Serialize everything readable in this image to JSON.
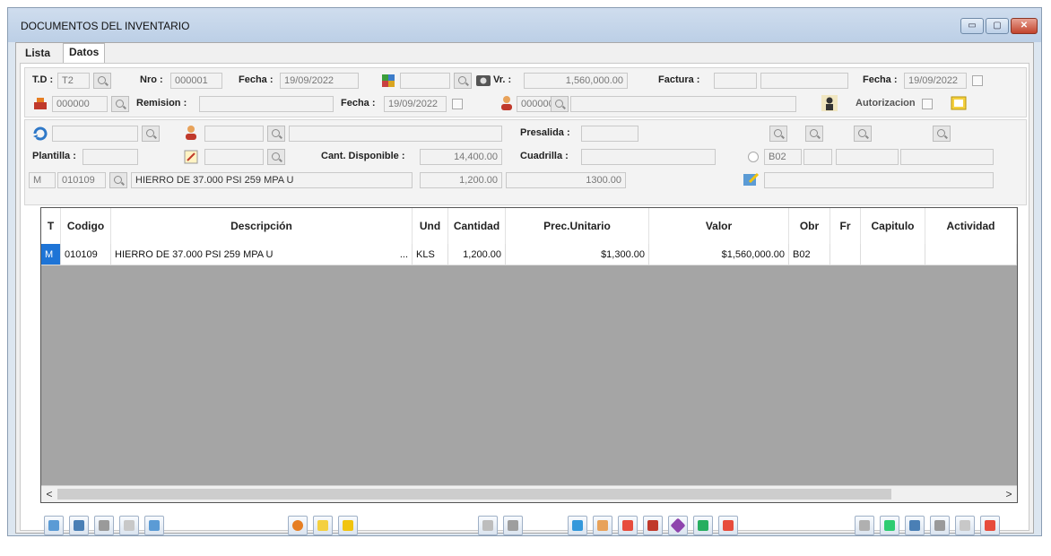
{
  "window": {
    "title": "DOCUMENTOS DEL INVENTARIO",
    "controls": {
      "minimize": "▭",
      "maximize": "▢",
      "close": "✕"
    }
  },
  "tabs": [
    "Lista",
    "Datos"
  ],
  "header": {
    "td_label": "T.D :",
    "td_value": "T2",
    "nro_label": "Nro :",
    "nro_value": "000001",
    "fecha1_label": "Fecha :",
    "fecha1_value": "19/09/2022",
    "vr_label": "Vr. :",
    "vr_value": "1,560,000.00",
    "factura_label": "Factura :",
    "fecha2_label": "Fecha :",
    "fecha2_value": "19/09/2022",
    "code1_value": "000000",
    "remision_label": "Remision :",
    "fecha3_label": "Fecha :",
    "fecha3_value": "19/09/2022",
    "code2_value": "000000",
    "autorizacion_label": "Autorizacion"
  },
  "detail": {
    "presalida_label": "Presalida :",
    "plantilla_label": "Plantilla :",
    "cant_disp_label": "Cant. Disponible :",
    "cant_disp_value": "14,400.00",
    "cuadrilla_label": "Cuadrilla :",
    "obr_value": "B02",
    "tipo_value": "M",
    "item_code": "010109",
    "item_desc": "HIERRO DE 37.000 PSI 259 MPA U",
    "item_qty": "1,200.00",
    "item_price": "1300.00"
  },
  "grid": {
    "columns": [
      "T",
      "Codigo",
      "Descripción",
      "Und",
      "Cantidad",
      "Prec.Unitario",
      "Valor",
      "Obr",
      "Fr",
      "Capitulo",
      "Actividad"
    ],
    "rows": [
      {
        "t": "M",
        "codigo": "010109",
        "descripcion": "HIERRO DE 37.000 PSI 259 MPA U",
        "ellipsis": "...",
        "und": "KLS",
        "cantidad": "1,200.00",
        "precio": "$1,300.00",
        "valor": "$1,560,000.00",
        "obr": "B02",
        "fr": "",
        "capitulo": "",
        "actividad": ""
      }
    ],
    "scroll_left": "<",
    "scroll_right": ">"
  },
  "colors": {
    "selected_type_cell": "#1e74d6",
    "grid_empty": "#a5a5a5"
  }
}
